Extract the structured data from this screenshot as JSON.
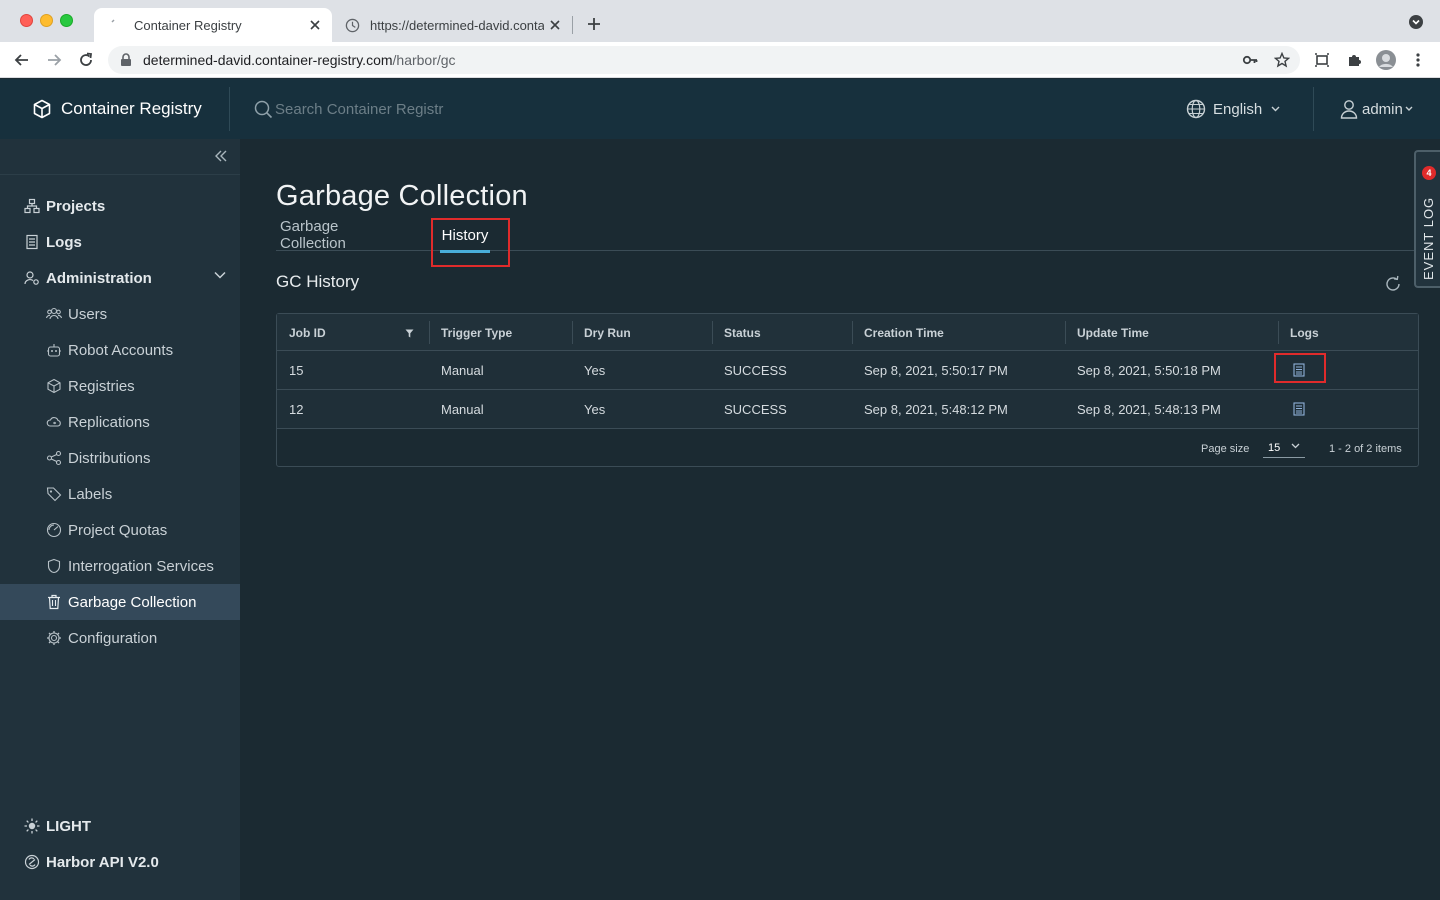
{
  "browser": {
    "tabs": [
      {
        "title": "Container Registry",
        "active": true
      },
      {
        "title": "https://determined-david.conta",
        "active": false
      }
    ],
    "url_host": "determined-david.container-registry.com",
    "url_path": "/harbor/gc"
  },
  "header": {
    "brand": "Container Registry",
    "search_placeholder": "Search Container Registr",
    "language": "English",
    "user": "admin"
  },
  "sidebar": {
    "items": [
      {
        "label": "Projects",
        "icon": "projects-icon"
      },
      {
        "label": "Logs",
        "icon": "logs-icon"
      },
      {
        "label": "Administration",
        "icon": "administration-icon"
      },
      {
        "label": "Users",
        "icon": "users-icon"
      },
      {
        "label": "Robot Accounts",
        "icon": "robot-icon"
      },
      {
        "label": "Registries",
        "icon": "registries-icon"
      },
      {
        "label": "Replications",
        "icon": "replications-icon"
      },
      {
        "label": "Distributions",
        "icon": "distributions-icon"
      },
      {
        "label": "Labels",
        "icon": "tag-icon"
      },
      {
        "label": "Project Quotas",
        "icon": "quota-icon"
      },
      {
        "label": "Interrogation Services",
        "icon": "shield-icon"
      },
      {
        "label": "Garbage Collection",
        "icon": "trash-icon",
        "active": true
      },
      {
        "label": "Configuration",
        "icon": "gear-icon"
      }
    ],
    "theme": "LIGHT",
    "api": "Harbor API V2.0"
  },
  "main": {
    "title": "Garbage Collection",
    "tabs": [
      {
        "label": "Garbage Collection",
        "active": false
      },
      {
        "label": "History",
        "active": true
      }
    ],
    "section_title": "GC History",
    "table": {
      "columns": [
        "Job ID",
        "Trigger Type",
        "Dry Run",
        "Status",
        "Creation Time",
        "Update Time",
        "Logs"
      ],
      "rows": [
        {
          "job_id": "15",
          "trigger": "Manual",
          "dry_run": "Yes",
          "status": "SUCCESS",
          "created": "Sep 8, 2021, 5:50:17 PM",
          "updated": "Sep 8, 2021, 5:50:18 PM"
        },
        {
          "job_id": "12",
          "trigger": "Manual",
          "dry_run": "Yes",
          "status": "SUCCESS",
          "created": "Sep 8, 2021, 5:48:12 PM",
          "updated": "Sep 8, 2021, 5:48:13 PM"
        }
      ],
      "page_size_label": "Page size",
      "page_size": "15",
      "pager_info": "1 - 2 of 2 items"
    }
  },
  "event_log": {
    "label": "EVENT LOG",
    "count": "4"
  },
  "colors": {
    "accent": "#49aeda",
    "highlight": "#e02b2b",
    "header_bg": "#17303d",
    "sidebar_bg": "#21323c",
    "main_bg": "#1b2a32"
  }
}
